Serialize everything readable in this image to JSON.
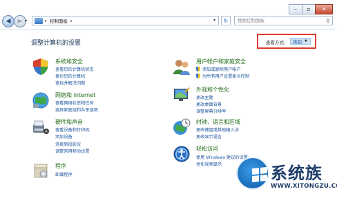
{
  "window": {
    "minimize_icon": "minimize-icon",
    "maximize_icon": "maximize-icon",
    "close_icon": "close-icon",
    "close_color": "#c8482f"
  },
  "address": {
    "breadcrumb": "控制面板",
    "separator": "▸",
    "search_placeholder": "搜索控制面板"
  },
  "main": {
    "title": "调整计算机的设置",
    "view_label": "查看方式:",
    "view_value": "类别",
    "highlight_color": "#e03a2f"
  },
  "left": [
    {
      "title": "系统和安全",
      "icon": "system-security-icon",
      "links": [
        "查看您的计算机状态",
        "备份您的计算机",
        "查找并解决问题"
      ]
    },
    {
      "title": "网络和 Internet",
      "icon": "network-icon",
      "links": [
        "查看网络状态和任务",
        "选择家庭组和共享选项"
      ]
    },
    {
      "title": "硬件和声音",
      "icon": "hardware-sound-icon",
      "links": [
        "查看设备和打印机",
        "添加设备",
        "连接到投影仪",
        "调整常用移动设置"
      ]
    },
    {
      "title": "程序",
      "icon": "programs-icon",
      "links": [
        "卸载程序"
      ]
    }
  ],
  "right": [
    {
      "title": "用户帐户和家庭安全",
      "icon": "user-accounts-icon",
      "links": [
        "添加或删除用户帐户",
        "为所有用户设置家长控制"
      ]
    },
    {
      "title": "外观和个性化",
      "icon": "appearance-icon",
      "links": [
        "更改主题",
        "更改桌面背景",
        "调整屏幕分辨率"
      ]
    },
    {
      "title": "时钟、语言和区域",
      "icon": "clock-globe-icon",
      "links": [
        "更改键盘或其他输入法",
        "更改显示语言"
      ]
    },
    {
      "title": "轻松访问",
      "icon": "ease-of-access-icon",
      "links": [
        "使用 Windows 建议的设置",
        "优化视频显示"
      ]
    }
  ],
  "watermark": {
    "brand": "系统族",
    "url": "WWW.XITONGZU.COM"
  }
}
